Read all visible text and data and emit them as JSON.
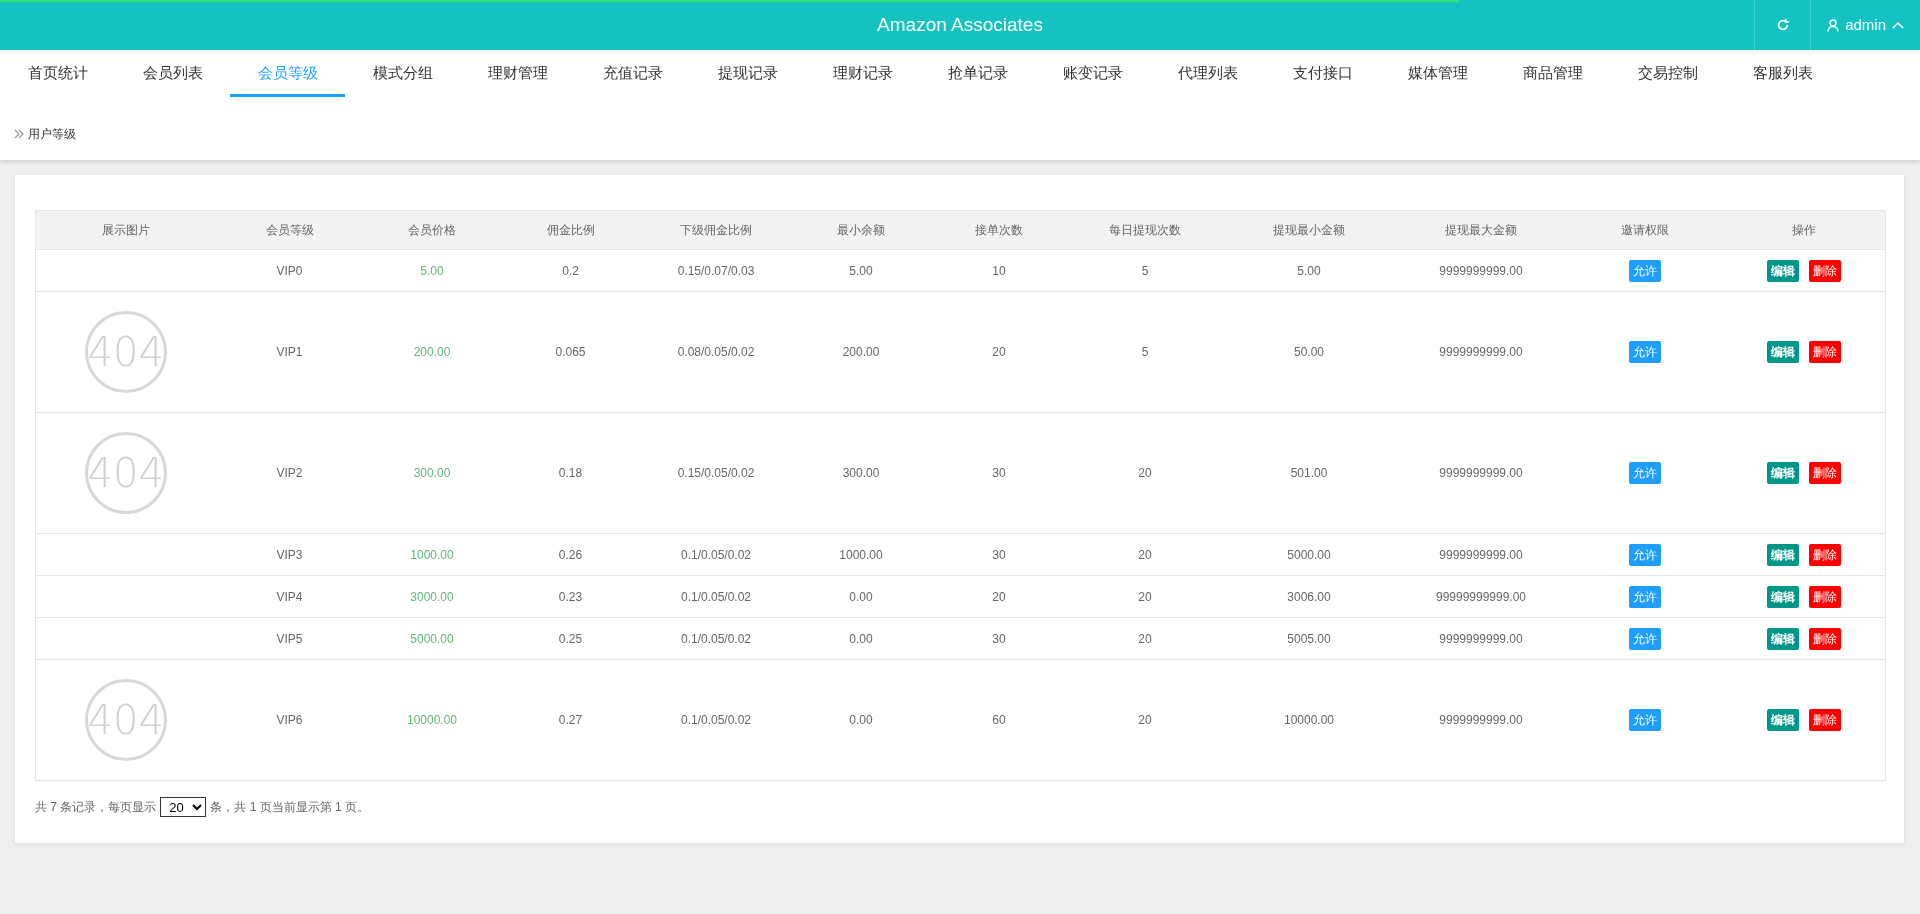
{
  "loading_bar": {
    "level": 0.76
  },
  "header": {
    "title": "Amazon Associates",
    "user": "admin"
  },
  "nav": [
    {
      "label": "首页统计",
      "selected": false
    },
    {
      "label": "会员列表",
      "selected": false
    },
    {
      "label": "会员等级",
      "selected": true
    },
    {
      "label": "模式分组",
      "selected": false
    },
    {
      "label": "理财管理",
      "selected": false
    },
    {
      "label": "充值记录",
      "selected": false
    },
    {
      "label": "提现记录",
      "selected": false
    },
    {
      "label": "理财记录",
      "selected": false
    },
    {
      "label": "抢单记录",
      "selected": false
    },
    {
      "label": "账变记录",
      "selected": false
    },
    {
      "label": "代理列表",
      "selected": false
    },
    {
      "label": "支付接口",
      "selected": false
    },
    {
      "label": "媒体管理",
      "selected": false
    },
    {
      "label": "商品管理",
      "selected": false
    },
    {
      "label": "交易控制",
      "selected": false
    },
    {
      "label": "客服列表",
      "selected": false
    }
  ],
  "breadcrumb": "用户等级",
  "table": {
    "columns": [
      "展示图片",
      "会员等级",
      "会员价格",
      "佣金比例",
      "下级佣金比例",
      "最小余额",
      "接单次数",
      "每日提现次数",
      "提现最小金额",
      "提现最大金额",
      "邀请权限",
      "操作"
    ],
    "rows": [
      {
        "image_text": null,
        "level": "VIP0",
        "price": "5.00",
        "commission": "0.2",
        "sub_commission": "0.15/0.07/0.03",
        "min_balance": "5.00",
        "orders": "10",
        "daily_withdrawals": "5",
        "min_withdraw": "5.00",
        "max_withdraw": "9999999999.00",
        "invite": "允许",
        "edit": "编辑",
        "delete": "删除"
      },
      {
        "image_text": "404",
        "level": "VIP1",
        "price": "200.00",
        "commission": "0.065",
        "sub_commission": "0.08/0.05/0.02",
        "min_balance": "200.00",
        "orders": "20",
        "daily_withdrawals": "5",
        "min_withdraw": "50.00",
        "max_withdraw": "9999999999.00",
        "invite": "允许",
        "edit": "编辑",
        "delete": "删除"
      },
      {
        "image_text": "404",
        "level": "VIP2",
        "price": "300.00",
        "commission": "0.18",
        "sub_commission": "0.15/0.05/0.02",
        "min_balance": "300.00",
        "orders": "30",
        "daily_withdrawals": "20",
        "min_withdraw": "501.00",
        "max_withdraw": "9999999999.00",
        "invite": "允许",
        "edit": "编辑",
        "delete": "删除"
      },
      {
        "image_text": null,
        "level": "VIP3",
        "price": "1000.00",
        "commission": "0.26",
        "sub_commission": "0.1/0.05/0.02",
        "min_balance": "1000.00",
        "orders": "30",
        "daily_withdrawals": "20",
        "min_withdraw": "5000.00",
        "max_withdraw": "9999999999.00",
        "invite": "允许",
        "edit": "编辑",
        "delete": "删除"
      },
      {
        "image_text": null,
        "level": "VIP4",
        "price": "3000.00",
        "commission": "0.23",
        "sub_commission": "0.1/0.05/0.02",
        "min_balance": "0.00",
        "orders": "20",
        "daily_withdrawals": "20",
        "min_withdraw": "3006.00",
        "max_withdraw": "99999999999.00",
        "invite": "允许",
        "edit": "编辑",
        "delete": "删除"
      },
      {
        "image_text": null,
        "level": "VIP5",
        "price": "5000.00",
        "commission": "0.25",
        "sub_commission": "0.1/0.05/0.02",
        "min_balance": "0.00",
        "orders": "30",
        "daily_withdrawals": "20",
        "min_withdraw": "5005.00",
        "max_withdraw": "9999999999.00",
        "invite": "允许",
        "edit": "编辑",
        "delete": "删除"
      },
      {
        "image_text": "404",
        "level": "VIP6",
        "price": "10000.00",
        "commission": "0.27",
        "sub_commission": "0.1/0.05/0.02",
        "min_balance": "0.00",
        "orders": "60",
        "daily_withdrawals": "20",
        "min_withdraw": "10000.00",
        "max_withdraw": "9999999999.00",
        "invite": "允许",
        "edit": "编辑",
        "delete": "删除"
      }
    ]
  },
  "pagination": {
    "prefix": "共 7 条记录，每页显示",
    "page_size": "20",
    "suffix": "条，共 1 页当前显示第 1 页。"
  }
}
